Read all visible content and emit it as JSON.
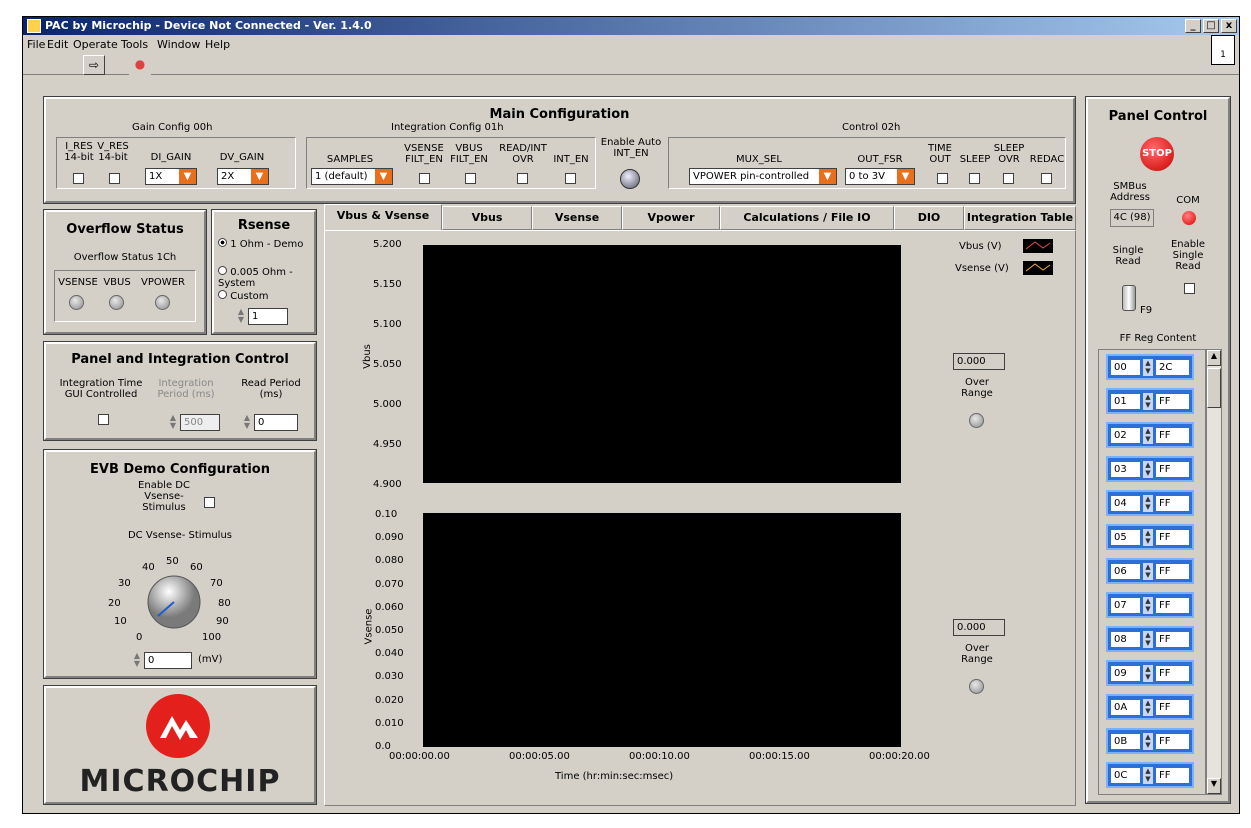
{
  "window": {
    "title": "PAC by Microchip - Device Not Connected - Ver. 1.4.0",
    "minimize": "_",
    "maximize": "□",
    "close": "x"
  },
  "menu": [
    "File",
    "Edit",
    "Operate",
    "Tools",
    "Window",
    "Help"
  ],
  "toolbar": {
    "run": "⇨",
    "stop": "●",
    "vi_icon": "1"
  },
  "main_config": {
    "title": "Main Configuration",
    "gain": {
      "title": "Gain Config 00h",
      "i_res": "I_RES 14-bit",
      "v_res": "V_RES 14-bit",
      "di_gain_label": "DI_GAIN",
      "di_gain": "1X",
      "dv_gain_label": "DV_GAIN",
      "dv_gain": "2X"
    },
    "integration": {
      "title": "Integration Config 01h",
      "samples_label": "SAMPLES",
      "samples": "1 (default)",
      "vsense_filt": "VSENSE FILT_EN",
      "vbus_filt": "VBUS FILT_EN",
      "read_int": "READ/INT OVR",
      "int_en": "INT_EN"
    },
    "auto_int": "Enable Auto INT_EN",
    "control": {
      "title": "Control 02h",
      "mux_label": "MUX_SEL",
      "mux": "VPOWER pin-controlled",
      "fsr_label": "OUT_FSR",
      "fsr": "0 to 3V",
      "timeout": "TIME OUT",
      "sleep": "SLEEP",
      "sleep_ovr": "SLEEP OVR",
      "redac": "REDAC"
    }
  },
  "overflow": {
    "title": "Overflow Status",
    "sub": "Overflow Status 1Ch",
    "leds": [
      "VSENSE",
      "VBUS",
      "VPOWER"
    ]
  },
  "rsense": {
    "title": "Rsense",
    "options": [
      "1 Ohm - Demo",
      "0.005 Ohm - System",
      "Custom"
    ],
    "value": "1"
  },
  "panel_int": {
    "title": "Panel and Integration Control",
    "int_time": "Integration Time GUI Controlled",
    "int_period": "Integration Period (ms)",
    "int_period_val": "500",
    "read_period": "Read Period (ms)",
    "read_period_val": "0"
  },
  "evb": {
    "title": "EVB Demo Configuration",
    "enable_dc": "Enable DC Vsense- Stimulus",
    "dc_label": "DC Vsense- Stimulus",
    "dial_labels": [
      "0",
      "10",
      "20",
      "30",
      "40",
      "50",
      "60",
      "70",
      "80",
      "90",
      "100"
    ],
    "value": "0",
    "unit": "(mV)"
  },
  "logo": {
    "text": "MICROCHIP"
  },
  "tabs": [
    "Vbus & Vsense",
    "Vbus",
    "Vsense",
    "Vpower",
    "Calculations / File IO",
    "DIO",
    "Integration Table"
  ],
  "chart_data": [
    {
      "type": "line",
      "ylabel": "Vbus",
      "ylim": [
        4.9,
        5.2
      ],
      "yticks": [
        "5.200",
        "5.150",
        "5.100",
        "5.050",
        "5.000",
        "4.950",
        "4.900"
      ],
      "series": [
        {
          "name": "Vbus (V)",
          "values": []
        }
      ]
    },
    {
      "type": "line",
      "ylabel": "Vsense",
      "xlabel": "Time (hr:min:sec:msec)",
      "ylim": [
        0,
        0.1
      ],
      "yticks": [
        "0.10",
        "0.090",
        "0.080",
        "0.070",
        "0.060",
        "0.050",
        "0.040",
        "0.030",
        "0.020",
        "0.010",
        "0.0"
      ],
      "xticks": [
        "00:00:00.00",
        "00:00:05.00",
        "00:00:10.00",
        "00:00:15.00",
        "00:00:20.00"
      ],
      "series": [
        {
          "name": "Vsense (V)",
          "values": []
        }
      ]
    }
  ],
  "legend": [
    "Vbus (V)",
    "Vsense (V)"
  ],
  "over_range": {
    "label": "Over Range",
    "vbus_val": "0.000",
    "vsense_val": "0.000"
  },
  "panel_control": {
    "title": "Panel Control",
    "stop": "STOP",
    "smbus_label": "SMBus Address",
    "smbus": "4C (98)",
    "com": "COM",
    "single_read": "Single Read",
    "enable_single": "Enable Single Read",
    "key": "F9",
    "ff_title": "FF Reg Content",
    "regs": [
      {
        "a": "00",
        "v": "2C"
      },
      {
        "a": "01",
        "v": "FF"
      },
      {
        "a": "02",
        "v": "FF"
      },
      {
        "a": "03",
        "v": "FF"
      },
      {
        "a": "04",
        "v": "FF"
      },
      {
        "a": "05",
        "v": "FF"
      },
      {
        "a": "06",
        "v": "FF"
      },
      {
        "a": "07",
        "v": "FF"
      },
      {
        "a": "08",
        "v": "FF"
      },
      {
        "a": "09",
        "v": "FF"
      },
      {
        "a": "0A",
        "v": "FF"
      },
      {
        "a": "0B",
        "v": "FF"
      },
      {
        "a": "0C",
        "v": "FF"
      }
    ]
  }
}
